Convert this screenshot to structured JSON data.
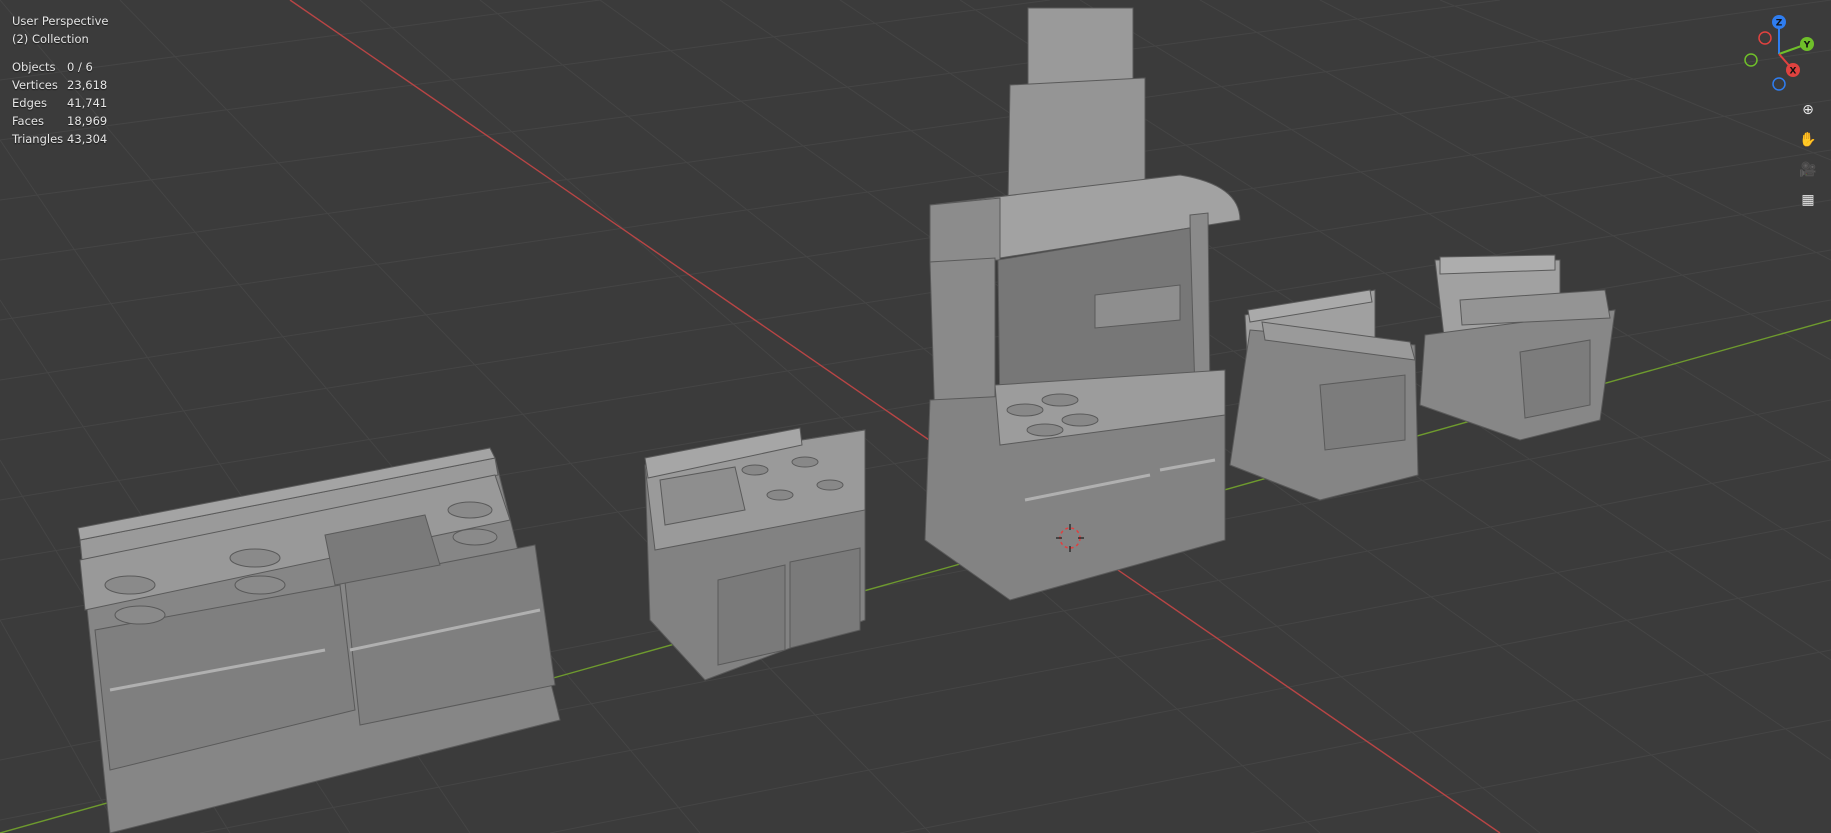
{
  "viewport": {
    "view_name": "User Perspective",
    "collection": "(2) Collection",
    "stats": [
      {
        "label": "Objects",
        "value": "0 / 6"
      },
      {
        "label": "Vertices",
        "value": "23,618"
      },
      {
        "label": "Edges",
        "value": "41,741"
      },
      {
        "label": "Faces",
        "value": "18,969"
      },
      {
        "label": "Triangles",
        "value": "43,304"
      }
    ]
  },
  "gizmo": {
    "axes": [
      {
        "name": "Z",
        "color": "#2f7df0"
      },
      {
        "name": "Y",
        "color": "#6fbf2a"
      },
      {
        "name": "X",
        "color": "#e0423f"
      }
    ]
  },
  "tools": [
    {
      "name": "zoom-icon",
      "glyph": "⊕"
    },
    {
      "name": "hand-pan-icon",
      "glyph": "✋"
    },
    {
      "name": "camera-icon",
      "glyph": "🎥"
    },
    {
      "name": "grid-perspective-icon",
      "glyph": "▦"
    }
  ],
  "colors": {
    "background": "#3b3b3b",
    "grid": "#474747",
    "x_axis": "#c44a4a",
    "y_axis": "#6e9a2e",
    "mesh": "#8c8c8c"
  }
}
